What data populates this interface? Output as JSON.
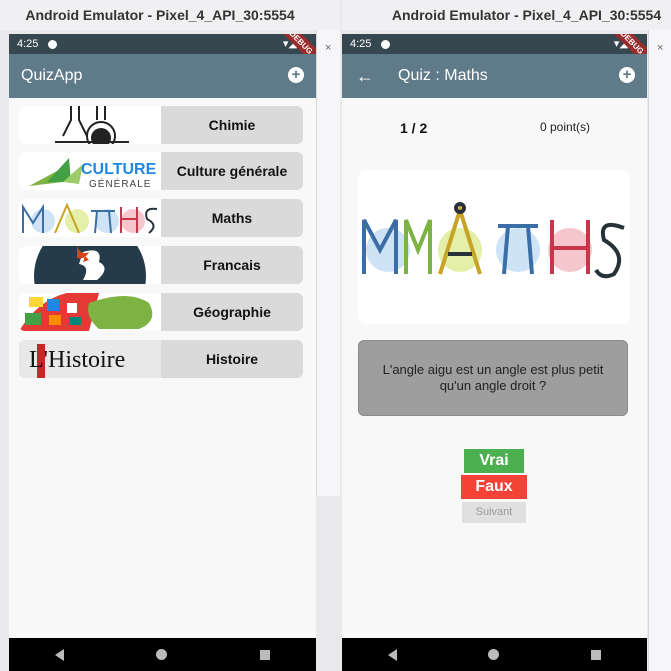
{
  "left_window": {
    "title": "Android Emulator - Pixel_4_API_30:5554",
    "status_time": "4:25",
    "debug_banner": "DEBUG",
    "app_title": "QuizApp",
    "categories": [
      {
        "label": "Chimie",
        "image": "chemistry-flask-icon"
      },
      {
        "label": "Culture générale",
        "image_text": "CULTURE",
        "image_sub": "GÉNÉRALE"
      },
      {
        "label": "Maths",
        "image": "maths-letters-image"
      },
      {
        "label": "Francais",
        "image": "rooster-icon"
      },
      {
        "label": "Géographie",
        "image": "map-mosaic-image"
      },
      {
        "label": "Histoire",
        "image_text": "L'Histoire"
      }
    ]
  },
  "right_window": {
    "title": "Android Emulator - Pixel_4_API_30:5554",
    "status_time": "4:25",
    "debug_banner": "DEBUG",
    "app_title": "Quiz : Maths",
    "progress": "1 / 2",
    "score": "0 point(s)",
    "image_name": "maths-letters-image",
    "question": "L'angle aigu est un angle est plus petit qu'un angle droit ?",
    "buttons": {
      "true_label": "Vrai",
      "false_label": "Faux",
      "next_label": "Suivant"
    }
  },
  "colors": {
    "appbar": "#5f7a89",
    "statusbar": "#37474f",
    "vrai": "#4caf50",
    "faux": "#f44336"
  }
}
